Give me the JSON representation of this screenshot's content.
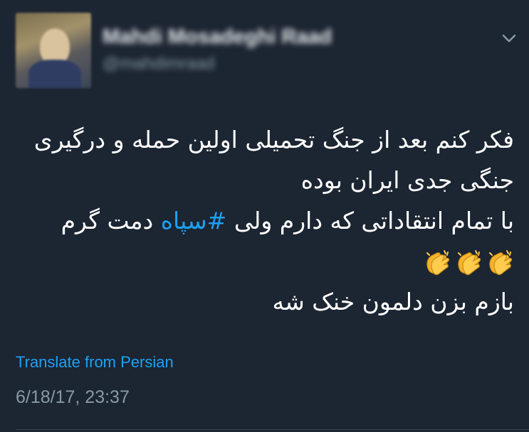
{
  "user": {
    "display_name": "Mahdi Mosadeghi Raad",
    "handle": "@mahdimraad"
  },
  "tweet": {
    "line1": "فکر کنم بعد از جنگ تحمیلی اولین حمله و درگیری",
    "line2": "جنگی جدی ایران بوده",
    "line3_before": "با تمام انتقاداتی که دارم ولی ",
    "hashtag": "#سپاه",
    "line3_after": " دمت گرم",
    "emojis": [
      "clapping-hands-icon",
      "clapping-hands-icon",
      "clapping-hands-icon"
    ],
    "line5": "بازم بزن دلمون خنک شه"
  },
  "translate_label": "Translate from Persian",
  "timestamp": "6/18/17, 23:37",
  "colors": {
    "background": "#1c2532",
    "text": "#ffffff",
    "link": "#1da1f2",
    "muted": "#8899a6"
  }
}
